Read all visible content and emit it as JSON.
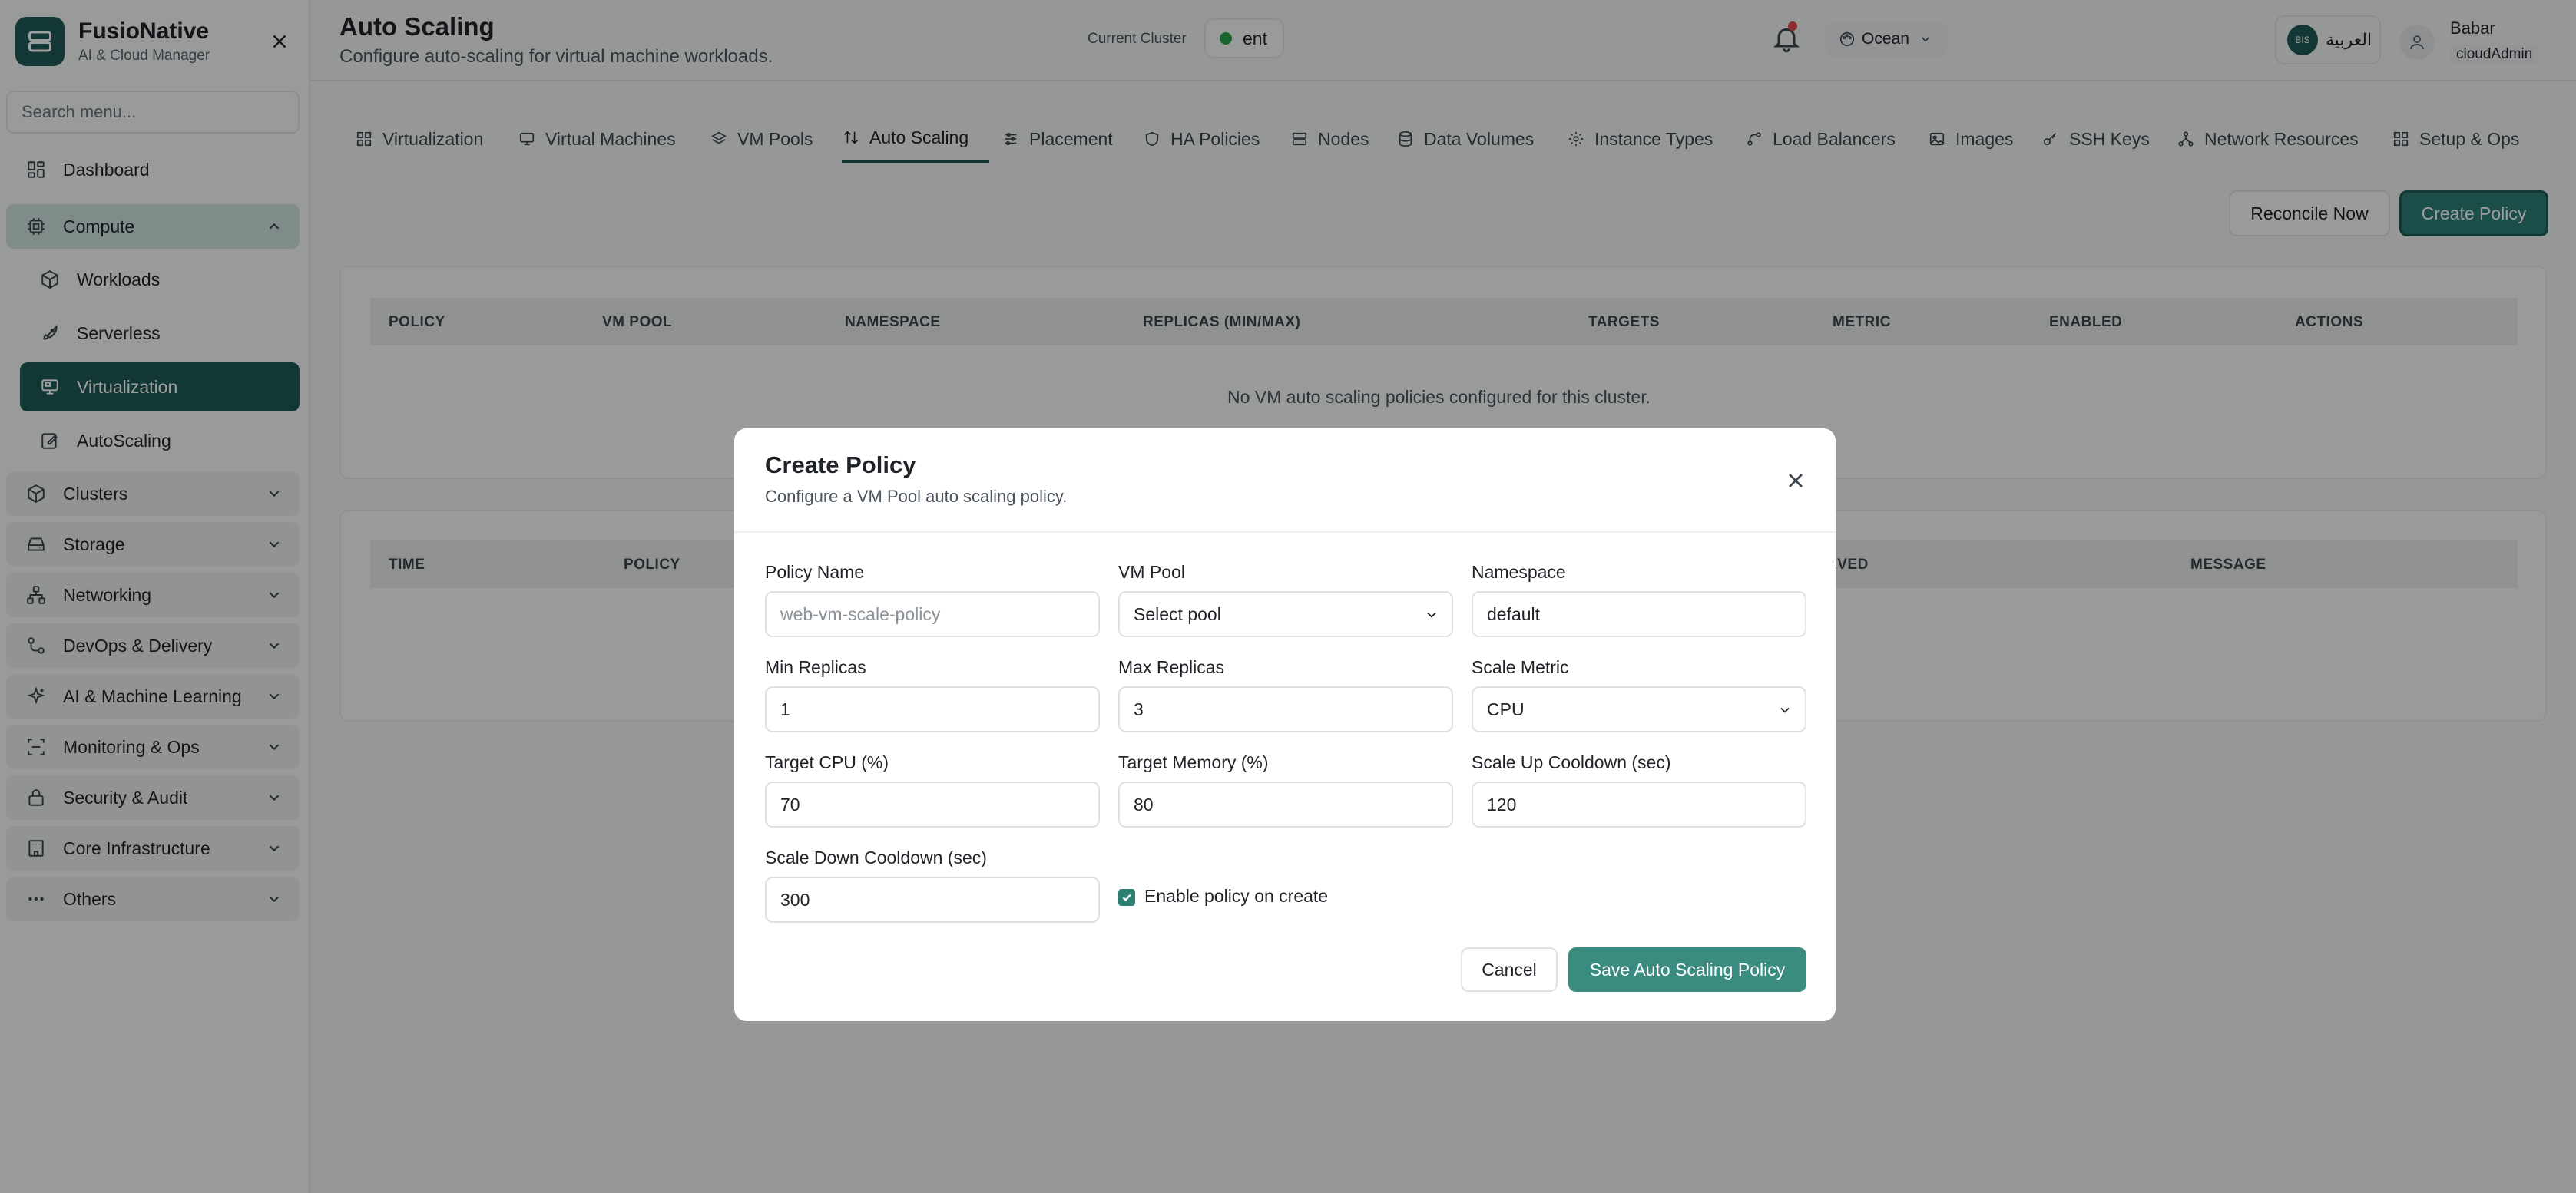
{
  "brand": {
    "name": "FusioNative",
    "subtitle": "AI & Cloud Manager"
  },
  "sidebar": {
    "search_placeholder": "Search menu...",
    "items": [
      {
        "label": "Dashboard",
        "icon": "dashboard-icon"
      },
      {
        "label": "Compute",
        "icon": "cpu-icon",
        "expanded": true
      },
      {
        "label": "Workloads",
        "icon": "box-icon"
      },
      {
        "label": "Serverless",
        "icon": "rocket-icon"
      },
      {
        "label": "Virtualization",
        "icon": "monitor-icon",
        "active": true
      },
      {
        "label": "AutoScaling",
        "icon": "edit-icon"
      },
      {
        "label": "Clusters",
        "icon": "cube-icon"
      },
      {
        "label": "Storage",
        "icon": "drive-icon"
      },
      {
        "label": "Networking",
        "icon": "network-icon"
      },
      {
        "label": "DevOps & Delivery",
        "icon": "pipeline-icon"
      },
      {
        "label": "AI & Machine Learning",
        "icon": "sparkles-icon"
      },
      {
        "label": "Monitoring & Ops",
        "icon": "scan-icon"
      },
      {
        "label": "Security & Audit",
        "icon": "lock-icon"
      },
      {
        "label": "Core Infrastructure",
        "icon": "building-icon"
      },
      {
        "label": "Others",
        "icon": "dots-icon"
      }
    ]
  },
  "header": {
    "title": "Auto Scaling",
    "subtitle": "Configure auto-scaling for virtual machine workloads.",
    "cluster_label": "Current Cluster",
    "cluster_value": "ent",
    "theme": "Ocean",
    "language": "العربية",
    "language_badge": "BIS",
    "user_name": "Babar",
    "user_role": "cloudAdmin"
  },
  "tabs": [
    "Virtualization",
    "Virtual Machines",
    "VM Pools",
    "Auto Scaling",
    "Placement",
    "HA Policies",
    "Nodes",
    "Data Volumes",
    "Instance Types",
    "Load Balancers",
    "Images",
    "SSH Keys",
    "Network Resources",
    "Setup & Ops"
  ],
  "actions": {
    "reconcile": "Reconcile Now",
    "create": "Create Policy"
  },
  "policies_table": {
    "headers": [
      "POLICY",
      "VM POOL",
      "NAMESPACE",
      "REPLICAS (MIN/MAX)",
      "TARGETS",
      "METRIC",
      "ENABLED",
      "ACTIONS"
    ],
    "empty": "No VM auto scaling policies configured for this cluster."
  },
  "events_table": {
    "headers": [
      "TIME",
      "POLICY",
      "SERVED",
      "MESSAGE"
    ]
  },
  "modal": {
    "title": "Create Policy",
    "subtitle": "Configure a VM Pool auto scaling policy.",
    "policy_name_label": "Policy Name",
    "policy_name_placeholder": "web-vm-scale-policy",
    "vm_pool_label": "VM Pool",
    "vm_pool_value": "Select pool",
    "namespace_label": "Namespace",
    "namespace_value": "default",
    "min_replicas_label": "Min Replicas",
    "min_replicas_value": "1",
    "max_replicas_label": "Max Replicas",
    "max_replicas_value": "3",
    "scale_metric_label": "Scale Metric",
    "scale_metric_value": "CPU",
    "target_cpu_label": "Target CPU (%)",
    "target_cpu_value": "70",
    "target_memory_label": "Target Memory (%)",
    "target_memory_value": "80",
    "scale_up_label": "Scale Up Cooldown (sec)",
    "scale_up_value": "120",
    "scale_down_label": "Scale Down Cooldown (sec)",
    "scale_down_value": "300",
    "enable_label": "Enable policy on create",
    "enable_checked": true,
    "cancel": "Cancel",
    "save": "Save Auto Scaling Policy"
  },
  "colors": {
    "accent": "#1f5a54",
    "primary_button": "#2d7f74",
    "status_green": "#22a447",
    "notification": "#e5484d"
  }
}
